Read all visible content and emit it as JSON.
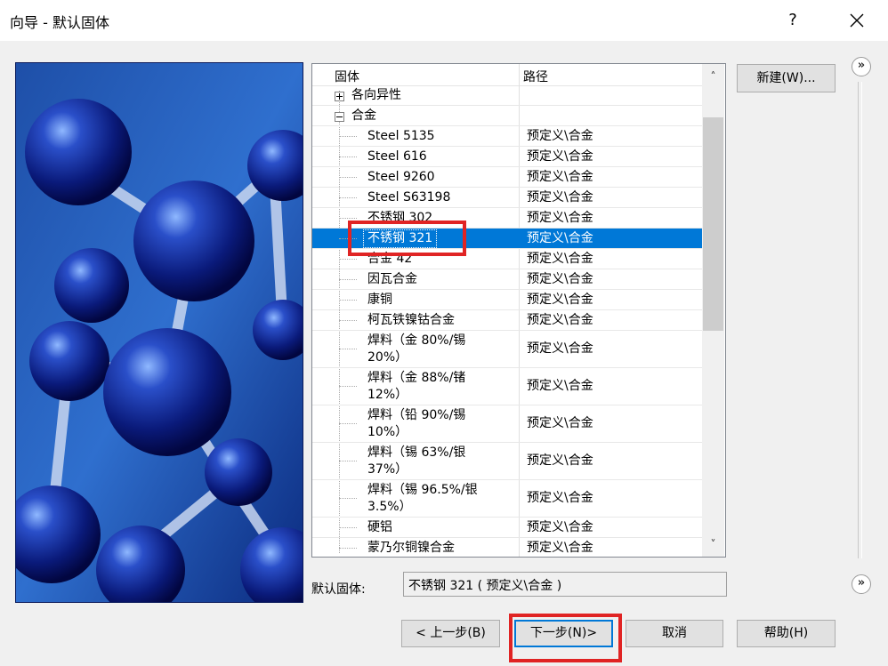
{
  "window": {
    "title": "向导 - 默认固体",
    "help_label": "?"
  },
  "tree": {
    "columns": [
      "固体",
      "路径"
    ],
    "groups": [
      {
        "label": "各向异性",
        "expanded": false
      },
      {
        "label": "合金",
        "expanded": true
      }
    ],
    "rows": [
      {
        "name": "Steel 5135",
        "path": "预定义\\合金"
      },
      {
        "name": "Steel 616",
        "path": "预定义\\合金"
      },
      {
        "name": "Steel 9260",
        "path": "预定义\\合金"
      },
      {
        "name": "Steel S63198",
        "path": "预定义\\合金"
      },
      {
        "name": "不锈钢 302",
        "path": "预定义\\合金"
      },
      {
        "name": "不锈钢 321",
        "path": "预定义\\合金",
        "selected": true
      },
      {
        "name": "合金 42",
        "path": "预定义\\合金"
      },
      {
        "name": "因瓦合金",
        "path": "预定义\\合金"
      },
      {
        "name": "康铜",
        "path": "预定义\\合金"
      },
      {
        "name": "柯瓦铁镍钴合金",
        "path": "预定义\\合金"
      },
      {
        "name": "焊料（金 80%/锡 20%）",
        "path": "预定义\\合金"
      },
      {
        "name": "焊料（金 88%/锗 12%）",
        "path": "预定义\\合金"
      },
      {
        "name": "焊料（铅 90%/锡 10%）",
        "path": "预定义\\合金"
      },
      {
        "name": "焊料（锡 63%/银 37%）",
        "path": "预定义\\合金"
      },
      {
        "name": "焊料（锡 96.5%/银 3.5%）",
        "path": "预定义\\合金"
      },
      {
        "name": "硬铝",
        "path": "预定义\\合金"
      },
      {
        "name": "蒙乃尔铜镍合金",
        "path": "预定义\\合金"
      }
    ]
  },
  "side_buttons": {
    "new": "新建(W)..."
  },
  "default_solid": {
    "label": "默认固体:",
    "value": "不锈钢 321 ( 预定义\\合金 )"
  },
  "footer": {
    "back": "< 上一步(B)",
    "next": "下一步(N)>",
    "cancel": "取消",
    "help": "帮助(H)"
  },
  "icons": {
    "expand_more": "»",
    "scroll_up": "˄",
    "scroll_down": "˅"
  },
  "colors": {
    "selection": "#0078d7",
    "highlight_box": "#e02424",
    "default_button_border": "#0078d7"
  }
}
